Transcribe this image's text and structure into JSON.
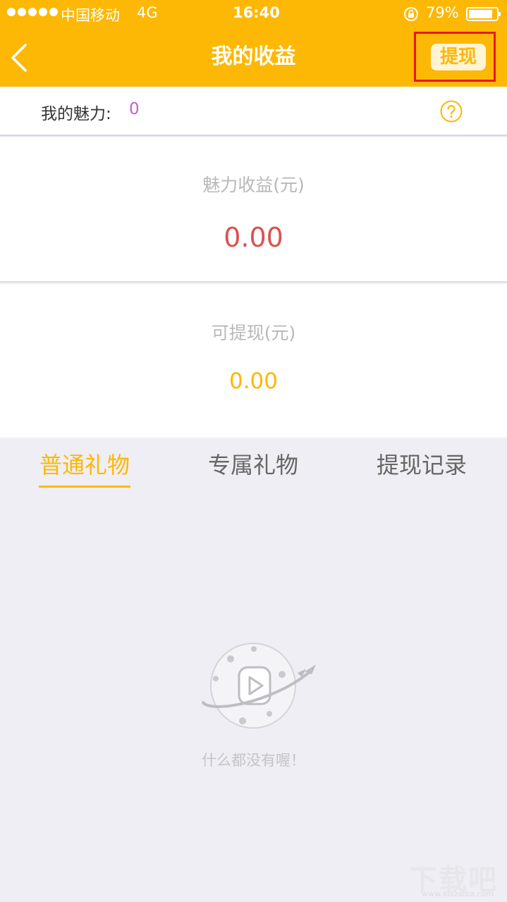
{
  "status_bar": {
    "carrier": "中国移动",
    "network": "4G",
    "time": "16:40",
    "battery": "79%"
  },
  "nav": {
    "back_icon": "chevron-left-icon",
    "title": "我的收益",
    "withdraw_label": "提现"
  },
  "charm": {
    "label": "我的魅力:",
    "value": "0",
    "help_icon": "question-circle-icon"
  },
  "earnings": {
    "label": "魅力收益(元)",
    "value": "0.00"
  },
  "withdrawable": {
    "label": "可提现(元)",
    "value": "0.00"
  },
  "tabs": [
    {
      "label": "普通礼物",
      "active": true
    },
    {
      "label": "专属礼物",
      "active": false
    },
    {
      "label": "提现记录",
      "active": false
    }
  ],
  "empty_state": {
    "text": "什么都没有喔！",
    "icon": "planet-play-icon"
  },
  "watermark": {
    "text": "下载吧",
    "url": "www.xiazaiba.com"
  },
  "colors": {
    "accent": "#fdb805",
    "earnings_value": "#d9534f",
    "charm_value": "#c95bd1",
    "highlight": "#e8191d"
  }
}
